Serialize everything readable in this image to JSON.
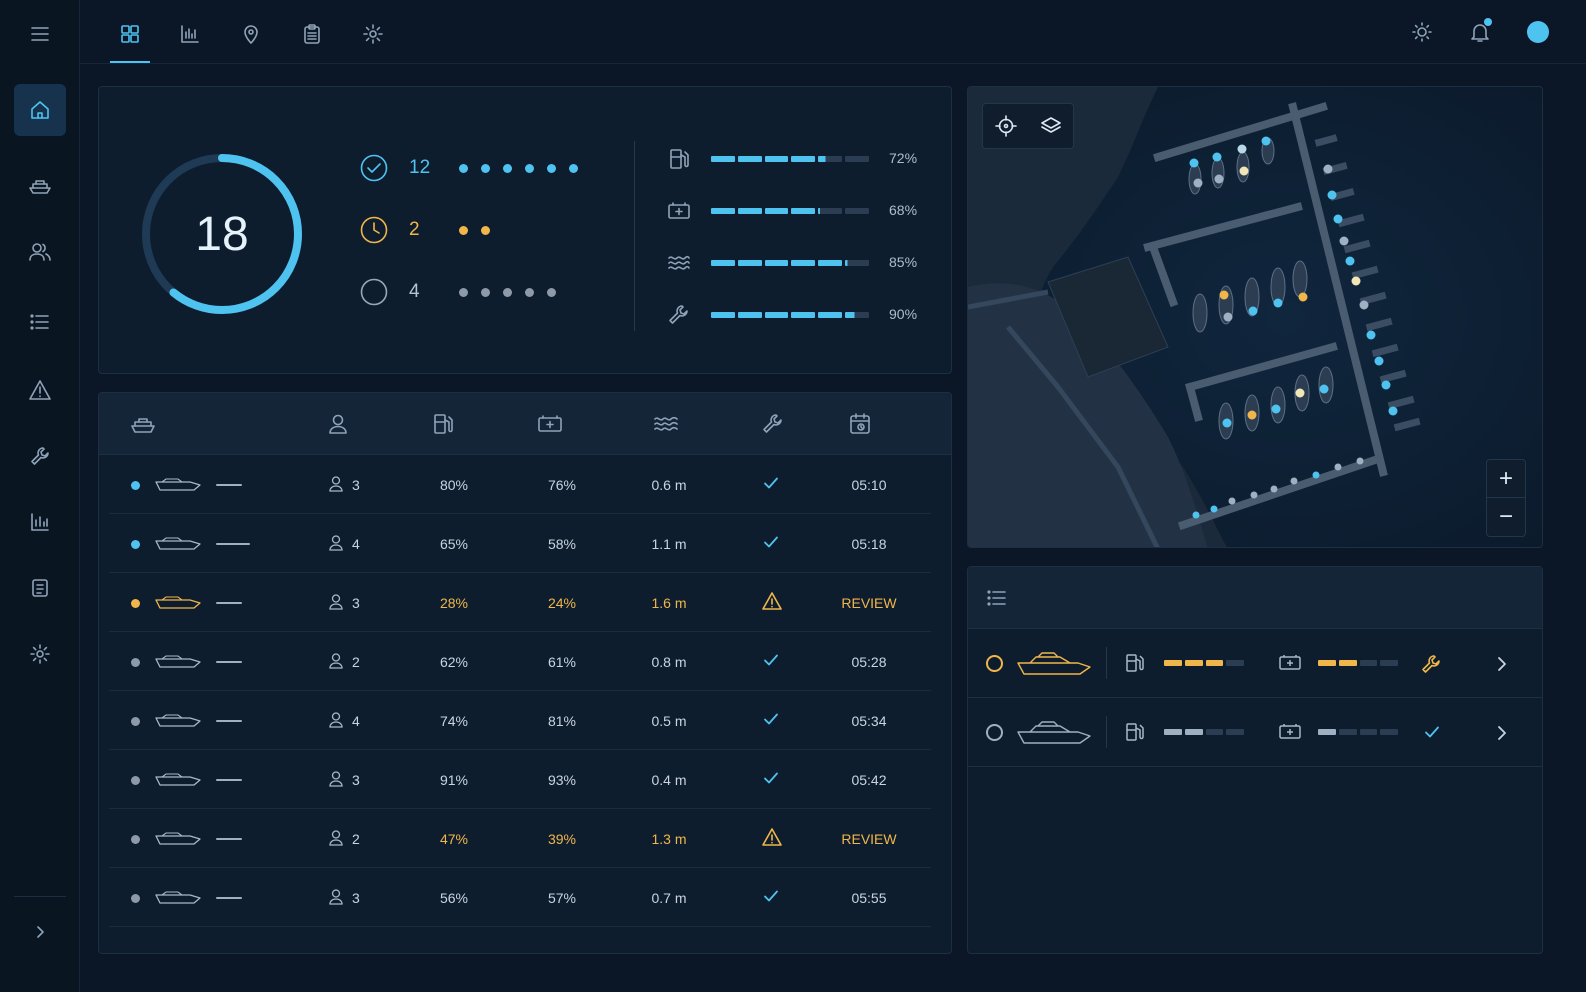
{
  "sidebar": {
    "items": [
      {
        "icon": "home-icon",
        "active": true
      },
      {
        "icon": "boat-icon"
      },
      {
        "icon": "users-icon"
      },
      {
        "icon": "list-icon"
      },
      {
        "icon": "alert-icon"
      },
      {
        "icon": "wrench-icon"
      },
      {
        "icon": "bar-chart-icon"
      },
      {
        "icon": "document-icon"
      },
      {
        "icon": "gear-icon"
      }
    ],
    "expand_icon": "chevron-right-icon"
  },
  "topbar": {
    "tabs": [
      "grid-icon",
      "bar-chart-icon",
      "map-pin-icon",
      "clipboard-icon",
      "gear-icon"
    ],
    "active_tab": 0
  },
  "summary": {
    "total": "18",
    "gauge_fraction": 0.61,
    "stats": [
      {
        "icon": "check-circle-icon",
        "count": "12",
        "dots": 6,
        "color": "#4fc3f0"
      },
      {
        "icon": "clock-icon",
        "count": "2",
        "dots": 2,
        "color": "#f1b64a"
      },
      {
        "icon": "empty-circle-icon",
        "count": "4",
        "dots": 5,
        "color": "#8e9aa8"
      }
    ],
    "meters": [
      {
        "icon": "fuel-icon",
        "value": "72%",
        "fraction": 0.72
      },
      {
        "icon": "battery-icon",
        "value": "68%",
        "fraction": 0.68
      },
      {
        "icon": "waves-icon",
        "value": "85%",
        "fraction": 0.85
      },
      {
        "icon": "wrench-icon",
        "value": "90%",
        "fraction": 0.9
      }
    ]
  },
  "table": {
    "columns": [
      "boat-icon",
      "person-icon",
      "fuel-icon",
      "battery-icon",
      "waves-icon",
      "wrench-icon",
      "calendar-icon"
    ],
    "rows": [
      {
        "dot": "#4fc3f0",
        "crew": "3",
        "fuel": "80%",
        "battery": "76%",
        "wave": "0.6 m",
        "status": "ok",
        "time": "05:10",
        "warn": false
      },
      {
        "dot": "#4fc3f0",
        "crew": "4",
        "fuel": "65%",
        "battery": "58%",
        "wave": "1.1 m",
        "status": "ok",
        "time": "05:18",
        "warn": false
      },
      {
        "dot": "#f1b64a",
        "crew": "3",
        "fuel": "28%",
        "battery": "24%",
        "wave": "1.6 m",
        "status": "warning",
        "time": "REVIEW",
        "warn": true
      },
      {
        "dot": "#8e9aa8",
        "crew": "2",
        "fuel": "62%",
        "battery": "61%",
        "wave": "0.8 m",
        "status": "ok",
        "time": "05:28",
        "warn": false
      },
      {
        "dot": "#8e9aa8",
        "crew": "4",
        "fuel": "74%",
        "battery": "81%",
        "wave": "0.5 m",
        "status": "ok",
        "time": "05:34",
        "warn": false
      },
      {
        "dot": "#8e9aa8",
        "crew": "3",
        "fuel": "91%",
        "battery": "93%",
        "wave": "0.4 m",
        "status": "ok",
        "time": "05:42",
        "warn": false
      },
      {
        "dot": "#8e9aa8",
        "crew": "2",
        "fuel": "47%",
        "battery": "39%",
        "wave": "1.3 m",
        "status": "warning",
        "time": "REVIEW",
        "warn": true
      },
      {
        "dot": "#8e9aa8",
        "crew": "3",
        "fuel": "56%",
        "battery": "57%",
        "wave": "0.7 m",
        "status": "ok",
        "time": "05:55",
        "warn": false
      }
    ]
  },
  "map": {
    "tools": [
      "crosshair-icon",
      "layers-icon"
    ],
    "zoom_in": "+",
    "zoom_out": "−"
  },
  "queue": {
    "header_icon": "list-icon",
    "rows": [
      {
        "ring": "#f1b64a",
        "boat_color": "#f1b64a",
        "fuel_level": 3,
        "battery_level": 2,
        "status": "wrench",
        "accent": "#f1b64a"
      },
      {
        "ring": "#9fb0c2",
        "boat_color": "#9fb0c2",
        "fuel_level": 2,
        "battery_level": 1,
        "status": "check",
        "accent": "#9fb0c2"
      }
    ]
  },
  "colors": {
    "accent": "#4fc3f0",
    "warning": "#f1b64a",
    "muted": "#8e9aa8"
  }
}
